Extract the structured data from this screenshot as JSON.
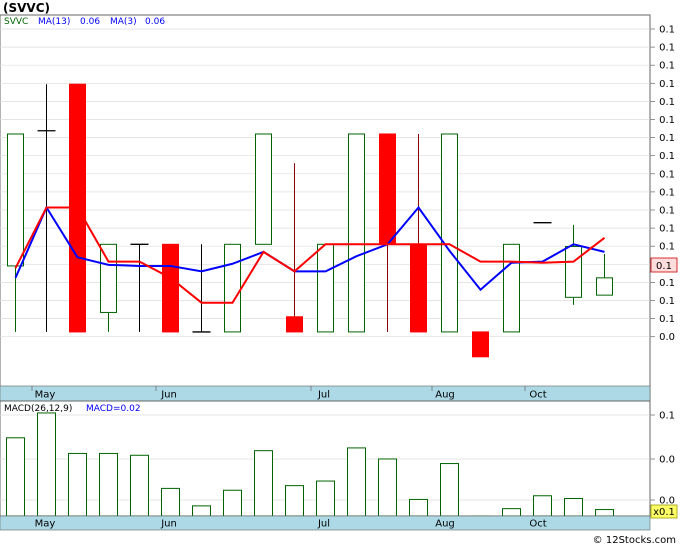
{
  "title": "(SVVC)",
  "footer": "© 12Stocks.com",
  "colors": {
    "up": "#006400",
    "down": "#ff0000",
    "ma13": "#0000ff",
    "ma3": "#ff0000",
    "axis_band": "#add8e6",
    "macd_bar": "#006400",
    "last_price_bg": "#ffdddd",
    "last_macd_bg": "#ffff66"
  },
  "price_panel": {
    "legend": [
      {
        "label": "SVVC",
        "color": "#006400"
      },
      {
        "label": "MA(13)",
        "color": "#0000ff"
      },
      {
        "label": "0.06",
        "color": "#0000ff"
      },
      {
        "label": "MA(3)",
        "color": "#0000ff"
      },
      {
        "label": "0.06",
        "color": "#0000ff"
      }
    ],
    "y_tick_labels": [
      "0.1",
      "0.1",
      "0.1",
      "0.1",
      "0.1",
      "0.1",
      "0.1",
      "0.1",
      "0.1",
      "0.1",
      "0.1",
      "0.1",
      "0.1",
      "0.1",
      "0.1",
      "0.1",
      "0.1",
      "0.0"
    ],
    "last_price_label": "0.1"
  },
  "macd_panel": {
    "legend": [
      {
        "label": "MACD(26,12,9)",
        "color": "#000000"
      },
      {
        "label": "MACD=0.02",
        "color": "#0000ff"
      }
    ],
    "y_tick_labels": [
      "0.1",
      "0.0",
      "0.0"
    ],
    "last_macd_label": "x0.1"
  },
  "x_axis_labels": [
    "May",
    "Jun",
    "Jul",
    "Aug",
    "Oct"
  ],
  "chart_data": [
    {
      "type": "candlestick",
      "series_name": "SVVC",
      "title": "(SVVC)",
      "x_labels": [
        "May",
        "Jun",
        "Jul",
        "Aug",
        "Oct"
      ],
      "y_scale_note": "all tick labels read 0.1 (bottom 0.0)",
      "candles": [
        {
          "open": 0.0614,
          "close": 0.0736,
          "high": 0.0736,
          "low": 0.0553,
          "dir": "up"
        },
        {
          "open": 0.0739,
          "close": 0.0739,
          "high": 0.0782,
          "low": 0.0553,
          "dir": "flat"
        },
        {
          "open": 0.0782,
          "close": 0.0553,
          "high": 0.0782,
          "low": 0.0553,
          "dir": "down"
        },
        {
          "open": 0.0571,
          "close": 0.0634,
          "high": 0.0634,
          "low": 0.0553,
          "dir": "up"
        },
        {
          "open": 0.0634,
          "close": 0.0634,
          "high": 0.0634,
          "low": 0.0553,
          "dir": "flat"
        },
        {
          "open": 0.0634,
          "close": 0.0553,
          "high": 0.0634,
          "low": 0.0553,
          "dir": "down"
        },
        {
          "open": 0.0553,
          "close": 0.0553,
          "high": 0.0634,
          "low": 0.0553,
          "dir": "flat"
        },
        {
          "open": 0.0553,
          "close": 0.0634,
          "high": 0.0634,
          "low": 0.0553,
          "dir": "up"
        },
        {
          "open": 0.0634,
          "close": 0.0736,
          "high": 0.0736,
          "low": 0.0634,
          "dir": "up"
        },
        {
          "open": 0.0567,
          "close": 0.0553,
          "high": 0.0709,
          "low": 0.0553,
          "dir": "down"
        },
        {
          "open": 0.0553,
          "close": 0.0634,
          "high": 0.0634,
          "low": 0.0553,
          "dir": "up"
        },
        {
          "open": 0.0553,
          "close": 0.0736,
          "high": 0.0736,
          "low": 0.0553,
          "dir": "up"
        },
        {
          "open": 0.0736,
          "close": 0.0634,
          "high": 0.0736,
          "low": 0.0553,
          "dir": "down"
        },
        {
          "open": 0.0634,
          "close": 0.0553,
          "high": 0.0736,
          "low": 0.0553,
          "dir": "down"
        },
        {
          "open": 0.0553,
          "close": 0.0736,
          "high": 0.0736,
          "low": 0.0553,
          "dir": "up"
        },
        {
          "open": 0.0553,
          "close": 0.053,
          "high": 0.0553,
          "low": 0.053,
          "dir": "down"
        },
        {
          "open": 0.0553,
          "close": 0.0634,
          "high": 0.0634,
          "low": 0.0553,
          "dir": "up"
        },
        {
          "open": 0.0654,
          "close": 0.0654,
          "high": 0.0654,
          "low": 0.0654,
          "dir": "flat"
        },
        {
          "open": 0.0585,
          "close": 0.0632,
          "high": 0.0652,
          "low": 0.0578,
          "dir": "up"
        },
        {
          "open": 0.0587,
          "close": 0.0603,
          "high": 0.0625,
          "low": 0.0587,
          "dir": "up"
        }
      ]
    },
    {
      "type": "line",
      "series": [
        {
          "name": "MA(13)",
          "color": "#0000ff",
          "values": [
            0.0603,
            0.0668,
            0.0622,
            0.0615,
            0.0614,
            0.0614,
            0.0609,
            0.0616,
            0.0627,
            0.0609,
            0.0609,
            0.0623,
            0.0634,
            0.0668,
            0.0628,
            0.0592,
            0.0617,
            0.0618,
            0.0634,
            0.0627
          ]
        },
        {
          "name": "MA(3)",
          "color": "#ff0000",
          "values": [
            0.0612,
            0.0668,
            0.0668,
            0.0618,
            0.0618,
            0.0603,
            0.058,
            0.058,
            0.0627,
            0.0609,
            0.0634,
            0.0634,
            0.0634,
            0.0634,
            0.0634,
            0.0618,
            0.0618,
            0.0617,
            0.0618,
            0.064
          ]
        }
      ]
    },
    {
      "type": "bar",
      "series_name": "MACD(26,12,9)",
      "latest_value_label": "MACD=0.02",
      "values": [
        0.085,
        0.112,
        0.068,
        0.068,
        0.066,
        0.03,
        0.011,
        0.028,
        0.071,
        0.033,
        0.038,
        0.074,
        0.062,
        0.018,
        0.057,
        0.0,
        0.008,
        0.022,
        0.019,
        0.007
      ]
    }
  ]
}
